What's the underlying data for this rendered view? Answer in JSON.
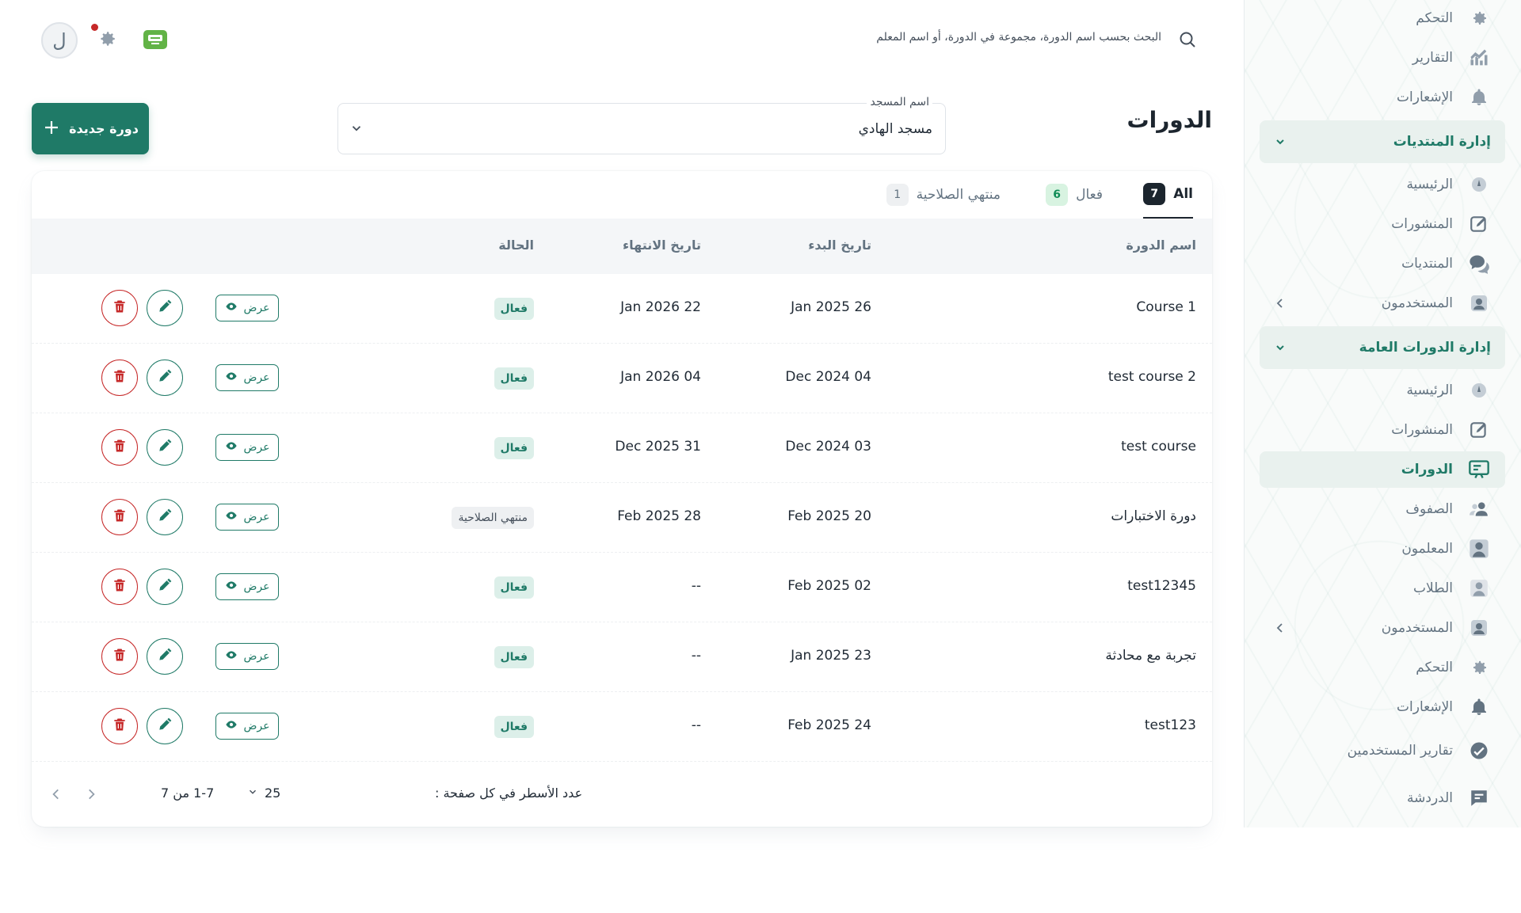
{
  "topbar": {
    "search_placeholder": "البحث بحسب اسم الدورة، مجموعة في الدورة، أو اسم المعلم",
    "avatar_letter": "ل"
  },
  "sidebar": {
    "items": [
      {
        "label": "التحكم",
        "icon": "gear-icon"
      },
      {
        "label": "التقارير",
        "icon": "chart-icon"
      },
      {
        "label": "الإشعارات",
        "icon": "bell-icon"
      },
      {
        "label": "إدارة المنتديات",
        "icon": "chevron-down-icon"
      },
      {
        "label": "الرئيسية",
        "icon": "home-icon"
      },
      {
        "label": "المنشورات",
        "icon": "edit-icon"
      },
      {
        "label": "المنتديات",
        "icon": "chat-icon"
      },
      {
        "label": "المستخدمون",
        "icon": "user-icon"
      },
      {
        "label": "إدارة الدورات العامة",
        "icon": "chevron-down-icon"
      },
      {
        "label": "الرئيسية",
        "icon": "home-icon"
      },
      {
        "label": "المنشورات",
        "icon": "edit-icon"
      },
      {
        "label": "الدورات",
        "icon": "course-icon"
      },
      {
        "label": "الصفوف",
        "icon": "class-icon"
      },
      {
        "label": "المعلمون",
        "icon": "teacher-icon"
      },
      {
        "label": "الطلاب",
        "icon": "student-icon"
      },
      {
        "label": "المستخدمون",
        "icon": "user-icon"
      },
      {
        "label": "التحكم",
        "icon": "gear-icon"
      },
      {
        "label": "الإشعارات",
        "icon": "bell-icon"
      },
      {
        "label": "تقارير المستخدمين",
        "icon": "report-icon"
      },
      {
        "label": "الدردشة",
        "icon": "message-icon"
      }
    ]
  },
  "header": {
    "title": "الدورات",
    "select_label": "اسم المسجد",
    "select_value": "مسجد الهادي",
    "new_button": "دورة جديدة"
  },
  "tabs": [
    {
      "label": "All",
      "count": "7"
    },
    {
      "label": "فعال",
      "count": "6"
    },
    {
      "label": "منتهي الصلاحية",
      "count": "1"
    }
  ],
  "table": {
    "columns": [
      "اسم الدورة",
      "تاريخ البدء",
      "تاريخ الانتهاء",
      "الحالة"
    ],
    "view_label": "عرض",
    "rows": [
      {
        "name": "Course 1",
        "start": "Jan 2025 26",
        "end": "Jan 2026 22",
        "status": "فعال",
        "state": "active"
      },
      {
        "name": "test course 2",
        "start": "Dec 2024 04",
        "end": "Jan 2026 04",
        "status": "فعال",
        "state": "active"
      },
      {
        "name": "test course",
        "start": "Dec 2024 03",
        "end": "Dec 2025 31",
        "status": "فعال",
        "state": "active"
      },
      {
        "name": "دورة الاختبارات",
        "start": "Feb 2025 20",
        "end": "Feb 2025 28",
        "status": "منتهي الصلاحية",
        "state": "expired"
      },
      {
        "name": "test12345",
        "start": "Feb 2025 02",
        "end": "--",
        "status": "فعال",
        "state": "active"
      },
      {
        "name": "تجربة مع محادثة",
        "start": "Jan 2025 23",
        "end": "--",
        "status": "فعال",
        "state": "active"
      },
      {
        "name": "test123",
        "start": "Feb 2025 24",
        "end": "--",
        "status": "فعال",
        "state": "active"
      }
    ]
  },
  "pagination": {
    "rows_per_page_label": "عدد الأسطر في كل صفحة :",
    "rows_per_page": "25",
    "range": "1-7 من 7"
  },
  "colors": {
    "primary": "#1f7a67",
    "danger": "#c62828",
    "text": "#212b36",
    "muted": "#637381"
  }
}
